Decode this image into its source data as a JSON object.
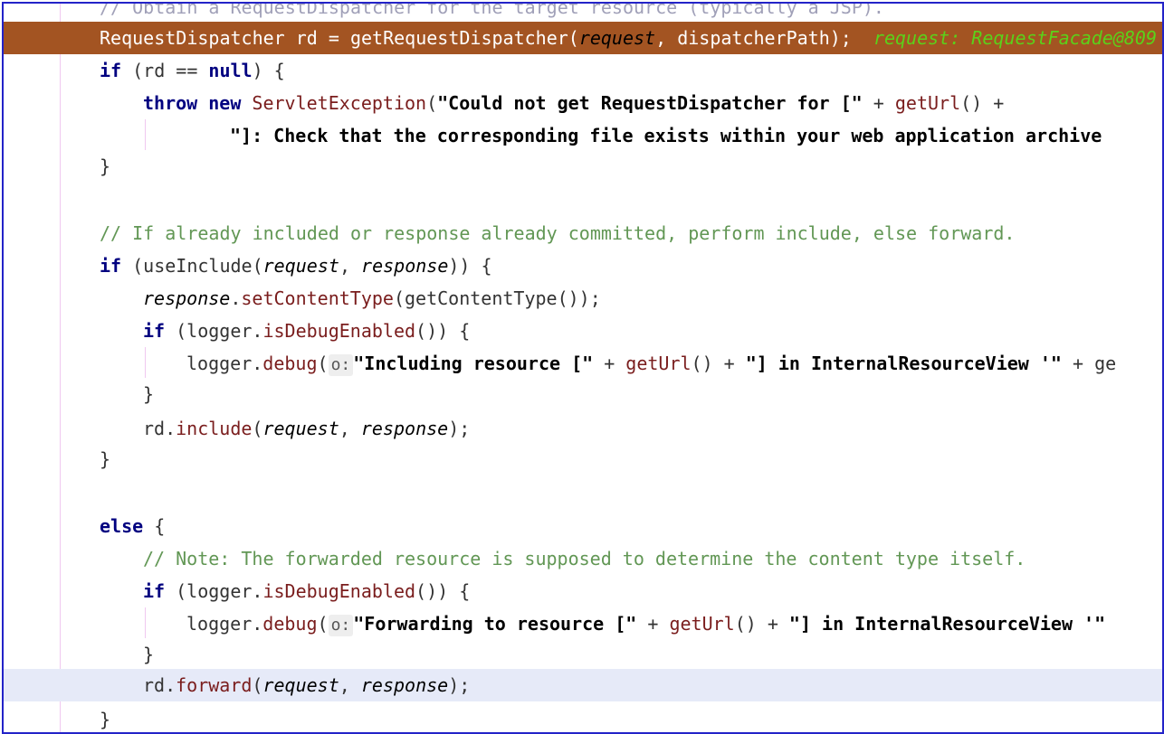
{
  "editor": {
    "lines": [
      {
        "id": "l0",
        "tokens": [
          {
            "t": "// Obtain a RequestDispatcher for the target resource (typically a JSP).",
            "c": "comment-top"
          }
        ]
      },
      {
        "id": "l1",
        "tokens": [
          {
            "t": "RequestDispatcher",
            "c": "tok-type"
          },
          {
            "t": " rd = getRequestDispatcher(",
            "c": "tok-plain"
          },
          {
            "t": "request",
            "c": "tok-param"
          },
          {
            "t": ", dispatcherPath);  ",
            "c": "tok-plain"
          },
          {
            "t": "request: RequestFacade@809",
            "c": "tok-inline"
          }
        ]
      },
      {
        "id": "l2",
        "tokens": [
          {
            "t": "if",
            "c": "tok-kw"
          },
          {
            "t": " (rd == ",
            "c": "tok-plain"
          },
          {
            "t": "null",
            "c": "tok-kw"
          },
          {
            "t": ") {",
            "c": "tok-plain"
          }
        ]
      },
      {
        "id": "l3",
        "tokens": [
          {
            "t": "throw new",
            "c": "tok-kw"
          },
          {
            "t": " ",
            "c": "tok-plain"
          },
          {
            "t": "ServletException",
            "c": "tok-cls"
          },
          {
            "t": "(",
            "c": "tok-plain"
          },
          {
            "t": "\"Could not get RequestDispatcher for [\"",
            "c": "tok-str"
          },
          {
            "t": " + ",
            "c": "tok-plain"
          },
          {
            "t": "getUrl",
            "c": "tok-method"
          },
          {
            "t": "() +",
            "c": "tok-plain"
          }
        ]
      },
      {
        "id": "l4",
        "tokens": [
          {
            "t": "\"]: Check that the corresponding file exists within your web application archive",
            "c": "tok-str"
          }
        ]
      },
      {
        "id": "l5",
        "tokens": [
          {
            "t": "}",
            "c": "tok-plain"
          }
        ]
      },
      {
        "id": "l6",
        "tokens": []
      },
      {
        "id": "l7",
        "tokens": [
          {
            "t": "// If already included or response already committed, perform include, else forward.",
            "c": "tok-comment"
          }
        ]
      },
      {
        "id": "l8",
        "tokens": [
          {
            "t": "if",
            "c": "tok-kw"
          },
          {
            "t": " (useInclude(",
            "c": "tok-plain"
          },
          {
            "t": "request",
            "c": "tok-param"
          },
          {
            "t": ", ",
            "c": "tok-plain"
          },
          {
            "t": "response",
            "c": "tok-param"
          },
          {
            "t": ")) {",
            "c": "tok-plain"
          }
        ]
      },
      {
        "id": "l9",
        "tokens": [
          {
            "t": "response",
            "c": "tok-param"
          },
          {
            "t": ".",
            "c": "tok-plain"
          },
          {
            "t": "setContentType",
            "c": "tok-method"
          },
          {
            "t": "(getContentType());",
            "c": "tok-plain"
          }
        ]
      },
      {
        "id": "l10",
        "tokens": [
          {
            "t": "if",
            "c": "tok-kw"
          },
          {
            "t": " (logger.",
            "c": "tok-plain"
          },
          {
            "t": "isDebugEnabled",
            "c": "tok-method"
          },
          {
            "t": "()) {",
            "c": "tok-plain"
          }
        ]
      },
      {
        "id": "l11",
        "tokens": [
          {
            "t": "logger.",
            "c": "tok-plain"
          },
          {
            "t": "debug",
            "c": "tok-method"
          },
          {
            "t": "(",
            "c": "tok-plain"
          },
          {
            "t": "o:",
            "c": "hint"
          },
          {
            "t": "\"Including resource [\"",
            "c": "tok-str"
          },
          {
            "t": " + ",
            "c": "tok-plain"
          },
          {
            "t": "getUrl",
            "c": "tok-method"
          },
          {
            "t": "() + ",
            "c": "tok-plain"
          },
          {
            "t": "\"] in InternalResourceView '\"",
            "c": "tok-str"
          },
          {
            "t": " + ge",
            "c": "tok-plain"
          }
        ]
      },
      {
        "id": "l12",
        "tokens": [
          {
            "t": "}",
            "c": "tok-plain"
          }
        ]
      },
      {
        "id": "l13",
        "tokens": [
          {
            "t": "rd.",
            "c": "tok-plain"
          },
          {
            "t": "include",
            "c": "tok-method"
          },
          {
            "t": "(",
            "c": "tok-plain"
          },
          {
            "t": "request",
            "c": "tok-param"
          },
          {
            "t": ", ",
            "c": "tok-plain"
          },
          {
            "t": "response",
            "c": "tok-param"
          },
          {
            "t": ");",
            "c": "tok-plain"
          }
        ]
      },
      {
        "id": "l14",
        "tokens": [
          {
            "t": "}",
            "c": "tok-plain"
          }
        ]
      },
      {
        "id": "l15",
        "tokens": []
      },
      {
        "id": "l16",
        "tokens": [
          {
            "t": "else",
            "c": "tok-kw"
          },
          {
            "t": " {",
            "c": "tok-plain"
          }
        ]
      },
      {
        "id": "l17",
        "tokens": [
          {
            "t": "// Note: The forwarded resource is supposed to determine the content type itself.",
            "c": "tok-comment"
          }
        ]
      },
      {
        "id": "l18",
        "tokens": [
          {
            "t": "if",
            "c": "tok-kw"
          },
          {
            "t": " (logger.",
            "c": "tok-plain"
          },
          {
            "t": "isDebugEnabled",
            "c": "tok-method"
          },
          {
            "t": "()) {",
            "c": "tok-plain"
          }
        ]
      },
      {
        "id": "l19",
        "tokens": [
          {
            "t": "logger.",
            "c": "tok-plain"
          },
          {
            "t": "debug",
            "c": "tok-method"
          },
          {
            "t": "(",
            "c": "tok-plain"
          },
          {
            "t": "o:",
            "c": "hint"
          },
          {
            "t": "\"Forwarding to resource [\"",
            "c": "tok-str"
          },
          {
            "t": " + ",
            "c": "tok-plain"
          },
          {
            "t": "getUrl",
            "c": "tok-method"
          },
          {
            "t": "() + ",
            "c": "tok-plain"
          },
          {
            "t": "\"] in InternalResourceView '\"",
            "c": "tok-str"
          }
        ]
      },
      {
        "id": "l20",
        "tokens": [
          {
            "t": "}",
            "c": "tok-plain"
          }
        ]
      },
      {
        "id": "l21",
        "tokens": [
          {
            "t": "rd.",
            "c": "tok-plain"
          },
          {
            "t": "forward",
            "c": "tok-method"
          },
          {
            "t": "(",
            "c": "tok-plain"
          },
          {
            "t": "request",
            "c": "tok-param"
          },
          {
            "t": ", ",
            "c": "tok-plain"
          },
          {
            "t": "response",
            "c": "tok-param"
          },
          {
            "t": ");",
            "c": "tok-plain"
          }
        ]
      },
      {
        "id": "l22",
        "tokens": [
          {
            "t": "}",
            "c": "tok-plain"
          }
        ]
      }
    ]
  }
}
